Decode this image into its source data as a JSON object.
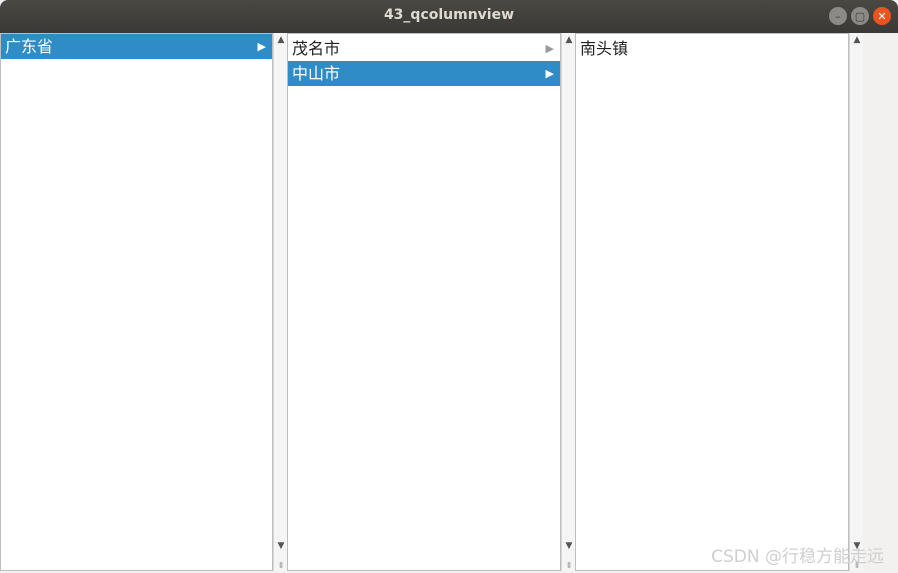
{
  "window": {
    "title": "43_qcolumnview",
    "min_symbol": "–",
    "max_symbol": "▢",
    "close_symbol": "✕"
  },
  "columns": [
    {
      "items": [
        {
          "label": "广东省",
          "selected": true,
          "has_children": true
        }
      ]
    },
    {
      "items": [
        {
          "label": "茂名市",
          "selected": false,
          "has_children": true
        },
        {
          "label": "中山市",
          "selected": true,
          "has_children": true
        }
      ]
    },
    {
      "items": [
        {
          "label": "南头镇",
          "selected": false,
          "has_children": false
        }
      ]
    }
  ],
  "scrollbar": {
    "up_symbol": "▲",
    "down_symbol": "▼",
    "grip_symbol": "⦀"
  },
  "expand_symbol": "▶",
  "watermark": "CSDN @行稳方能走远",
  "colors": {
    "selection": "#308cc6",
    "titlebar": "#3d3c38",
    "close_button": "#e95420"
  }
}
